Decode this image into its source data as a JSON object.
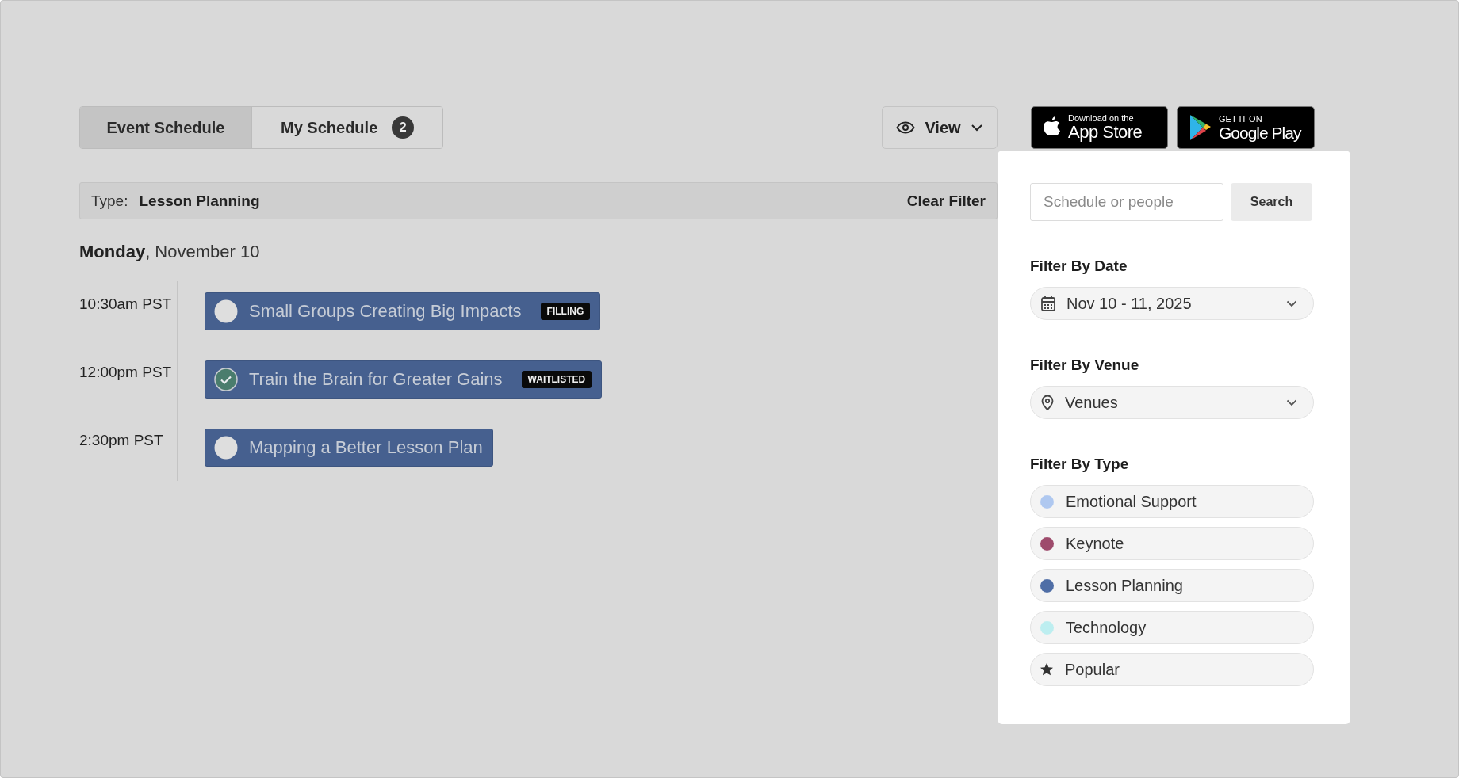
{
  "tabs": [
    {
      "label": "Event Schedule",
      "selected": true
    },
    {
      "label": "My Schedule",
      "selected": false,
      "count": "2"
    }
  ],
  "view_button": {
    "label": "View"
  },
  "app_store": {
    "small": "Download on the",
    "large": "App Store"
  },
  "google_play": {
    "small": "GET IT ON",
    "large": "Google Play"
  },
  "filter_bar": {
    "label": "Type:",
    "value": "Lesson Planning",
    "clear": "Clear Filter"
  },
  "date_heading": {
    "weekday": "Monday",
    "date": ", November 10"
  },
  "events": [
    {
      "time": "10:30am PST",
      "title": "Small Groups Creating Big Impacts",
      "checked": false,
      "badge": "FILLING"
    },
    {
      "time": "12:00pm PST",
      "title": "Train the Brain for Greater Gains",
      "checked": true,
      "badge": "WAITLISTED"
    },
    {
      "time": "2:30pm PST",
      "title": "Mapping a Better Lesson Plan",
      "checked": false
    }
  ],
  "panel": {
    "search": {
      "placeholder": "Schedule or people",
      "button": "Search"
    },
    "date_filter": {
      "label": "Filter By Date",
      "value": "Nov 10 - 11, 2025"
    },
    "venue_filter": {
      "label": "Filter By Venue",
      "value": "Venues"
    },
    "type_filter": {
      "label": "Filter By Type",
      "types": [
        {
          "kind": "dot",
          "label": "Emotional Support",
          "color": "#afc8f0"
        },
        {
          "kind": "dot",
          "label": "Keynote",
          "color": "#9e4b6c"
        },
        {
          "kind": "dot",
          "label": "Lesson Planning",
          "color": "#4f6ea6"
        },
        {
          "kind": "dot",
          "label": "Technology",
          "color": "#bdeef0"
        },
        {
          "kind": "star",
          "label": "Popular"
        }
      ]
    }
  }
}
